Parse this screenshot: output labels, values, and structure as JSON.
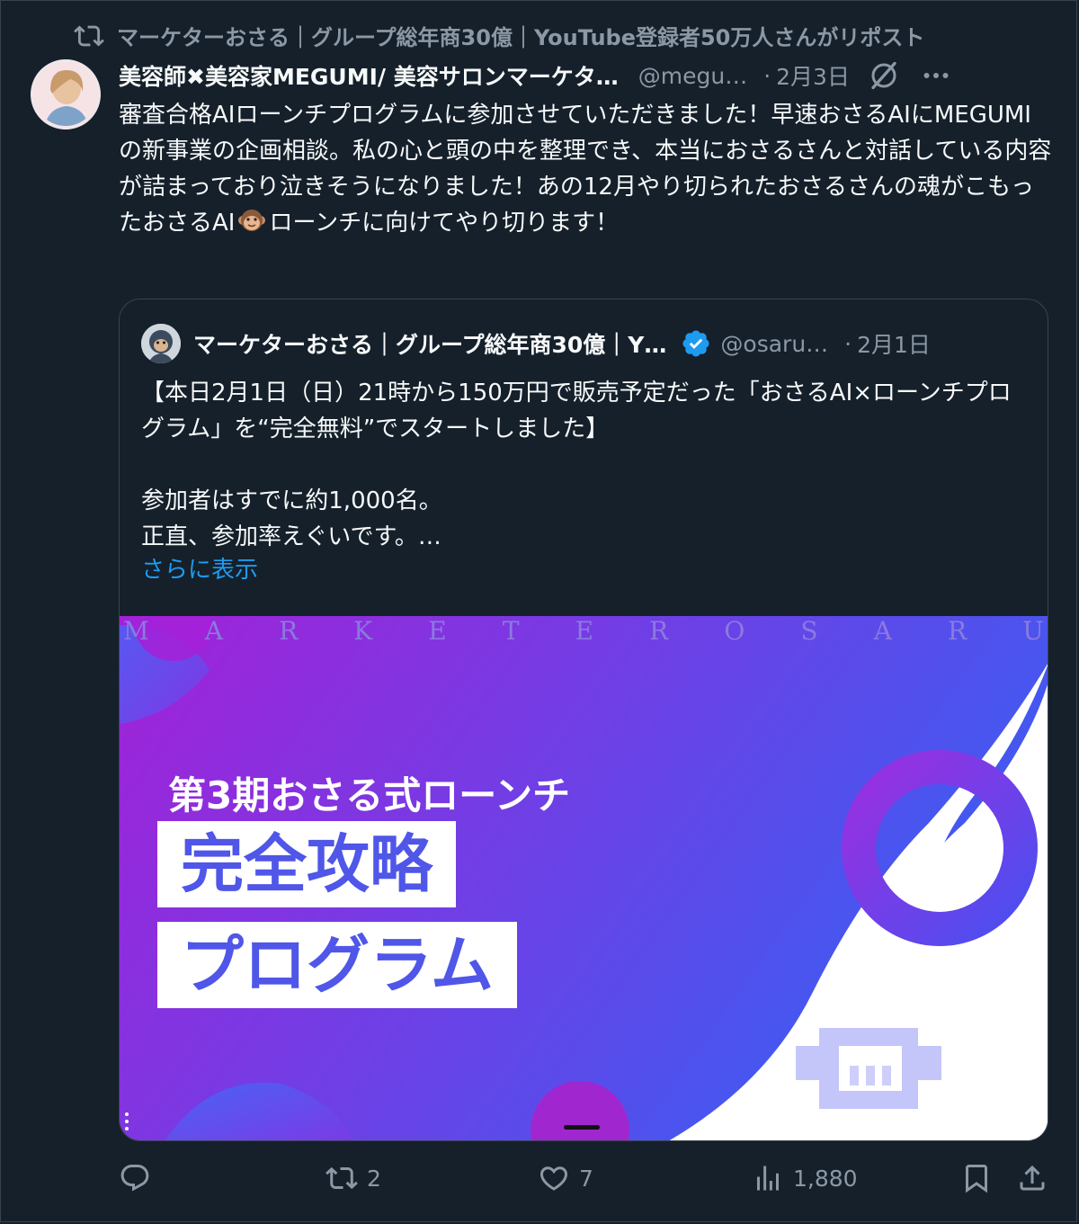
{
  "repost_line": {
    "text": "マーケターおさる｜グループ総年商30億｜YouTube登録者50万人さんがリポスト"
  },
  "tweet": {
    "author_name": "美容師✖美容家MEGUMI/ 美容サロンマーケタ…",
    "handle": "@megu…",
    "date": "2月3日",
    "text_before_emoji": "審査合格AIローンチプログラムに参加させていただきました！早速おさるAIにMEGUMIの新事業の企画相談。私の心と頭の中を整理でき、本当におさるさんと対話している内容が詰まっており泣きそうになりました！あの12月やり切られたおさるさんの魂がこもったおさるAI",
    "text_after_emoji": "ローンチに向けてやり切ります！"
  },
  "quoted": {
    "author_name": "マーケターおさる｜グループ総年商30億｜Y…",
    "handle": "@osaru…",
    "date": "2月1日",
    "text": "【本日2月1日（日）21時から150万円で販売予定だった「おさるAI×ローンチプログラム」を“完全無料”でスタートしました】\n\n参加者はすでに約1,000名。\n正直、参加率えぐいです。…",
    "show_more": "さらに表示",
    "media": {
      "letters": [
        "M",
        "A",
        "R",
        "K",
        "E",
        "T",
        "E",
        "R",
        "O",
        "S",
        "A",
        "R",
        "U"
      ],
      "subtitle": "第3期おさる式ローンチ",
      "line1": "完全攻略",
      "line2": "プログラム",
      "colors": {
        "gradient_start": "#a321d8",
        "gradient_end": "#3d5cf2",
        "title_text": "#4f56e8"
      }
    }
  },
  "actions": {
    "reply_count": "",
    "repost_count": "2",
    "like_count": "7",
    "views_count": "1,880"
  },
  "colors": {
    "background": "#15202b",
    "muted": "#8b98a5",
    "link": "#1d9bf0",
    "verified": "#1d9bf0"
  }
}
